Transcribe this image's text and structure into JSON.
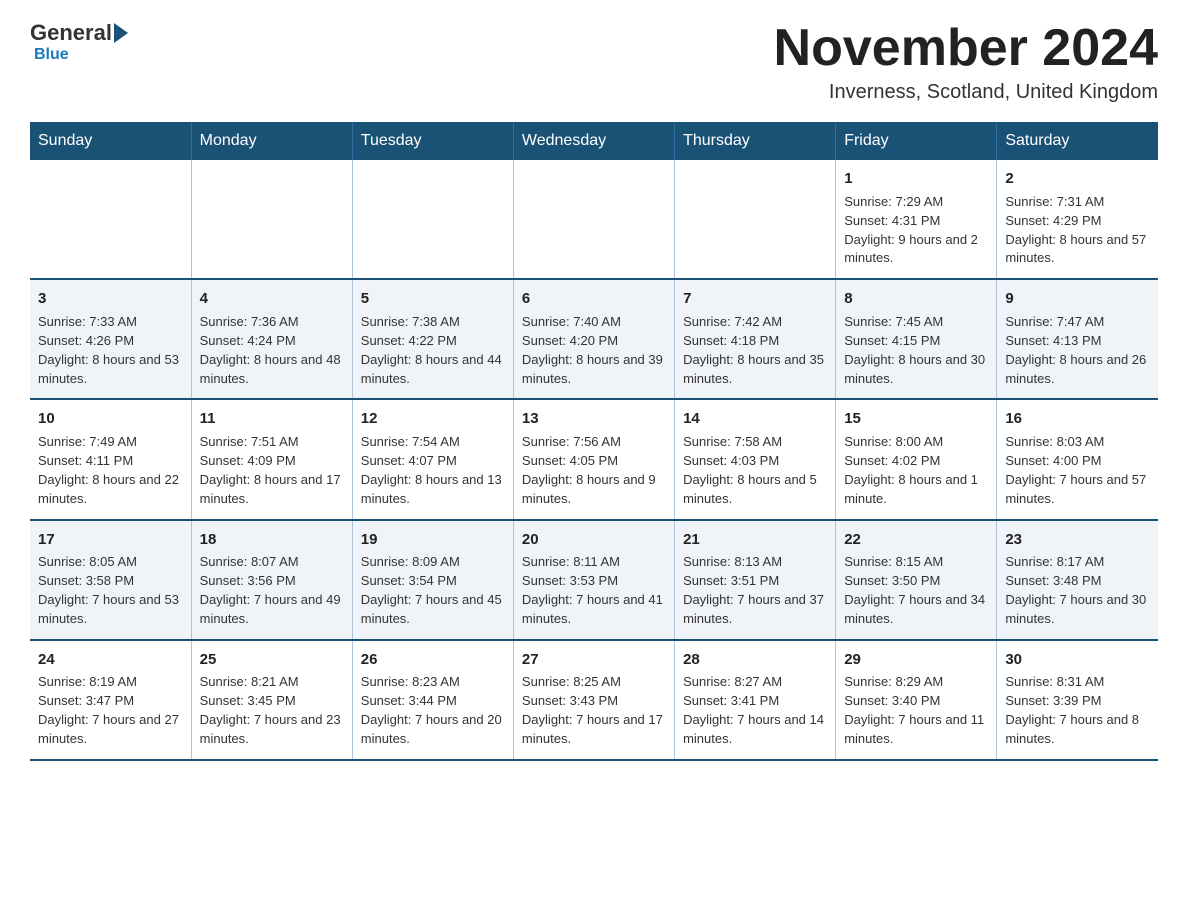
{
  "header": {
    "logo_general": "General",
    "logo_blue": "Blue",
    "main_title": "November 2024",
    "subtitle": "Inverness, Scotland, United Kingdom"
  },
  "days_of_week": [
    "Sunday",
    "Monday",
    "Tuesday",
    "Wednesday",
    "Thursday",
    "Friday",
    "Saturday"
  ],
  "weeks": [
    [
      {
        "day": "",
        "info": ""
      },
      {
        "day": "",
        "info": ""
      },
      {
        "day": "",
        "info": ""
      },
      {
        "day": "",
        "info": ""
      },
      {
        "day": "",
        "info": ""
      },
      {
        "day": "1",
        "info": "Sunrise: 7:29 AM\nSunset: 4:31 PM\nDaylight: 9 hours and 2 minutes."
      },
      {
        "day": "2",
        "info": "Sunrise: 7:31 AM\nSunset: 4:29 PM\nDaylight: 8 hours and 57 minutes."
      }
    ],
    [
      {
        "day": "3",
        "info": "Sunrise: 7:33 AM\nSunset: 4:26 PM\nDaylight: 8 hours and 53 minutes."
      },
      {
        "day": "4",
        "info": "Sunrise: 7:36 AM\nSunset: 4:24 PM\nDaylight: 8 hours and 48 minutes."
      },
      {
        "day": "5",
        "info": "Sunrise: 7:38 AM\nSunset: 4:22 PM\nDaylight: 8 hours and 44 minutes."
      },
      {
        "day": "6",
        "info": "Sunrise: 7:40 AM\nSunset: 4:20 PM\nDaylight: 8 hours and 39 minutes."
      },
      {
        "day": "7",
        "info": "Sunrise: 7:42 AM\nSunset: 4:18 PM\nDaylight: 8 hours and 35 minutes."
      },
      {
        "day": "8",
        "info": "Sunrise: 7:45 AM\nSunset: 4:15 PM\nDaylight: 8 hours and 30 minutes."
      },
      {
        "day": "9",
        "info": "Sunrise: 7:47 AM\nSunset: 4:13 PM\nDaylight: 8 hours and 26 minutes."
      }
    ],
    [
      {
        "day": "10",
        "info": "Sunrise: 7:49 AM\nSunset: 4:11 PM\nDaylight: 8 hours and 22 minutes."
      },
      {
        "day": "11",
        "info": "Sunrise: 7:51 AM\nSunset: 4:09 PM\nDaylight: 8 hours and 17 minutes."
      },
      {
        "day": "12",
        "info": "Sunrise: 7:54 AM\nSunset: 4:07 PM\nDaylight: 8 hours and 13 minutes."
      },
      {
        "day": "13",
        "info": "Sunrise: 7:56 AM\nSunset: 4:05 PM\nDaylight: 8 hours and 9 minutes."
      },
      {
        "day": "14",
        "info": "Sunrise: 7:58 AM\nSunset: 4:03 PM\nDaylight: 8 hours and 5 minutes."
      },
      {
        "day": "15",
        "info": "Sunrise: 8:00 AM\nSunset: 4:02 PM\nDaylight: 8 hours and 1 minute."
      },
      {
        "day": "16",
        "info": "Sunrise: 8:03 AM\nSunset: 4:00 PM\nDaylight: 7 hours and 57 minutes."
      }
    ],
    [
      {
        "day": "17",
        "info": "Sunrise: 8:05 AM\nSunset: 3:58 PM\nDaylight: 7 hours and 53 minutes."
      },
      {
        "day": "18",
        "info": "Sunrise: 8:07 AM\nSunset: 3:56 PM\nDaylight: 7 hours and 49 minutes."
      },
      {
        "day": "19",
        "info": "Sunrise: 8:09 AM\nSunset: 3:54 PM\nDaylight: 7 hours and 45 minutes."
      },
      {
        "day": "20",
        "info": "Sunrise: 8:11 AM\nSunset: 3:53 PM\nDaylight: 7 hours and 41 minutes."
      },
      {
        "day": "21",
        "info": "Sunrise: 8:13 AM\nSunset: 3:51 PM\nDaylight: 7 hours and 37 minutes."
      },
      {
        "day": "22",
        "info": "Sunrise: 8:15 AM\nSunset: 3:50 PM\nDaylight: 7 hours and 34 minutes."
      },
      {
        "day": "23",
        "info": "Sunrise: 8:17 AM\nSunset: 3:48 PM\nDaylight: 7 hours and 30 minutes."
      }
    ],
    [
      {
        "day": "24",
        "info": "Sunrise: 8:19 AM\nSunset: 3:47 PM\nDaylight: 7 hours and 27 minutes."
      },
      {
        "day": "25",
        "info": "Sunrise: 8:21 AM\nSunset: 3:45 PM\nDaylight: 7 hours and 23 minutes."
      },
      {
        "day": "26",
        "info": "Sunrise: 8:23 AM\nSunset: 3:44 PM\nDaylight: 7 hours and 20 minutes."
      },
      {
        "day": "27",
        "info": "Sunrise: 8:25 AM\nSunset: 3:43 PM\nDaylight: 7 hours and 17 minutes."
      },
      {
        "day": "28",
        "info": "Sunrise: 8:27 AM\nSunset: 3:41 PM\nDaylight: 7 hours and 14 minutes."
      },
      {
        "day": "29",
        "info": "Sunrise: 8:29 AM\nSunset: 3:40 PM\nDaylight: 7 hours and 11 minutes."
      },
      {
        "day": "30",
        "info": "Sunrise: 8:31 AM\nSunset: 3:39 PM\nDaylight: 7 hours and 8 minutes."
      }
    ]
  ]
}
